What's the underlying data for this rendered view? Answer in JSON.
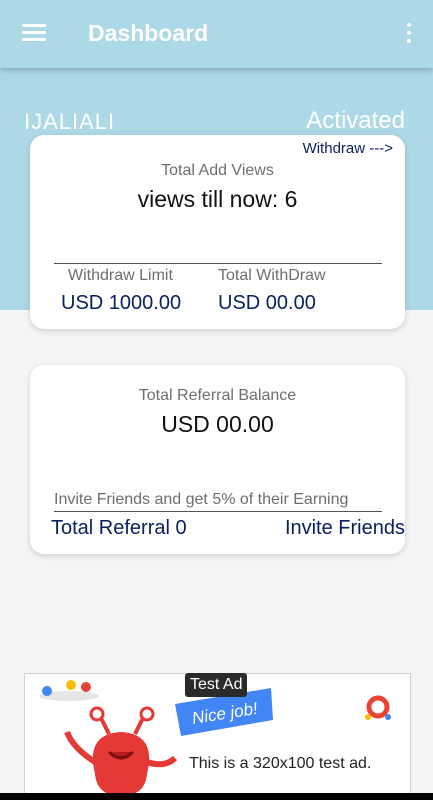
{
  "appbar": {
    "title": "Dashboard"
  },
  "profile": {
    "username": "IJALIALI",
    "status": "Activated"
  },
  "views_card": {
    "withdraw_link": "Withdraw --->",
    "label": "Total Add Views",
    "views_text": "views till now: 6",
    "withdraw_limit_label": "Withdraw Limit",
    "withdraw_limit_value": "USD 1000.00",
    "total_withdraw_label": "Total WithDraw",
    "total_withdraw_value": "USD 00.00"
  },
  "referral_card": {
    "label": "Total Referral Balance",
    "balance": "USD 00.00",
    "invite_note": "Invite Friends and get 5% of their Earning",
    "total_referral": "Total Referral 0",
    "invite_button": "Invite Friends"
  },
  "ad": {
    "label": "Test Ad",
    "badge": "Nice job!",
    "text": "This is a 320x100 test ad.",
    "colors": {
      "blue": "#4285f4",
      "red": "#ea4335",
      "yellow": "#fbbc05",
      "mascot": "#e53935"
    }
  },
  "colors": {
    "header": "#add8e6",
    "accent_text": "#0a1f5e",
    "background": "#f4f4f4"
  }
}
